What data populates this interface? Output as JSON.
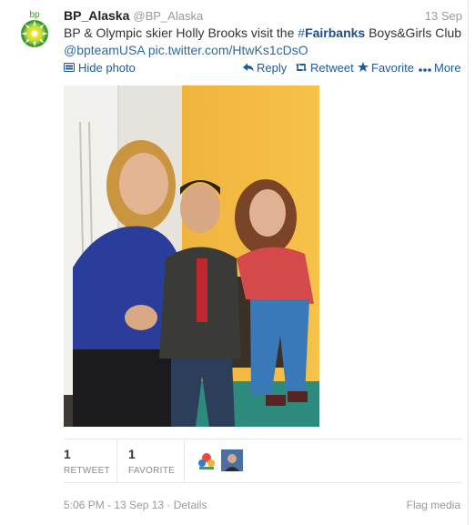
{
  "tweet": {
    "screen_name": "BP_Alaska",
    "handle": "@BP_Alaska",
    "timestamp": "13 Sep",
    "avatar_text": "bp",
    "text_part1": "BP & Olympic skier Holly Brooks visit the ",
    "hashtag_hash": "#",
    "hashtag_word": "Fairbanks",
    "text_part2": " Boys&Girls Club ",
    "mention": "@bpteamUSA",
    "link": "pic.twitter.com/HtwKs1cDsO"
  },
  "actions": {
    "hide_photo": "Hide photo",
    "reply": "Reply",
    "retweet": "Retweet",
    "favorite": "Favorite",
    "more": "More"
  },
  "stats": {
    "retweets_count": "1",
    "retweets_label": "RETWEET",
    "favorites_count": "1",
    "favorites_label": "FAVORITE"
  },
  "footer": {
    "datetime": "5:06 PM - 13 Sep 13",
    "details": "Details",
    "flag": "Flag media"
  },
  "colors": {
    "link": "#2b6aa5",
    "bp_green": "#3a9a2a",
    "bp_yellow": "#f2d21c"
  }
}
